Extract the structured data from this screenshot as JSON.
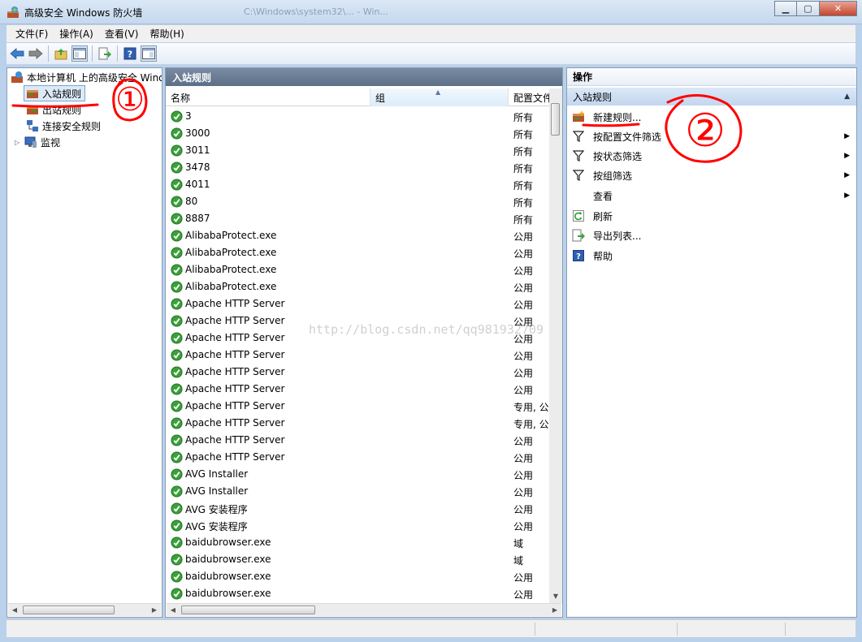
{
  "window": {
    "title": "高级安全 Windows 防火墙",
    "ghost_tab": "C:\\Windows\\system32\\... - Win..."
  },
  "menu": [
    "文件(F)",
    "操作(A)",
    "查看(V)",
    "帮助(H)"
  ],
  "tree": {
    "root": "本地计算机 上的高级安全 Windows 防火墙",
    "items": [
      {
        "label": "入站规则",
        "selected": true
      },
      {
        "label": "出站规则"
      },
      {
        "label": "连接安全规则"
      },
      {
        "label": "监视"
      }
    ]
  },
  "center": {
    "title": "入站规则",
    "columns": [
      "名称",
      "组",
      "配置文件"
    ],
    "rows": [
      {
        "name": "3",
        "profile": "所有"
      },
      {
        "name": "3000",
        "profile": "所有"
      },
      {
        "name": "3011",
        "profile": "所有"
      },
      {
        "name": "3478",
        "profile": "所有"
      },
      {
        "name": "4011",
        "profile": "所有"
      },
      {
        "name": "80",
        "profile": "所有"
      },
      {
        "name": "8887",
        "profile": "所有"
      },
      {
        "name": "AlibabaProtect.exe",
        "profile": "公用"
      },
      {
        "name": "AlibabaProtect.exe",
        "profile": "公用"
      },
      {
        "name": "AlibabaProtect.exe",
        "profile": "公用"
      },
      {
        "name": "AlibabaProtect.exe",
        "profile": "公用"
      },
      {
        "name": "Apache HTTP Server",
        "profile": "公用"
      },
      {
        "name": "Apache HTTP Server",
        "profile": "公用"
      },
      {
        "name": "Apache HTTP Server",
        "profile": "公用"
      },
      {
        "name": "Apache HTTP Server",
        "profile": "公用"
      },
      {
        "name": "Apache HTTP Server",
        "profile": "公用"
      },
      {
        "name": "Apache HTTP Server",
        "profile": "公用"
      },
      {
        "name": "Apache HTTP Server",
        "profile": "专用, 公用"
      },
      {
        "name": "Apache HTTP Server",
        "profile": "专用, 公用"
      },
      {
        "name": "Apache HTTP Server",
        "profile": "公用"
      },
      {
        "name": "Apache HTTP Server",
        "profile": "公用"
      },
      {
        "name": "AVG Installer",
        "profile": "公用"
      },
      {
        "name": "AVG Installer",
        "profile": "公用"
      },
      {
        "name": "AVG 安装程序",
        "profile": "公用"
      },
      {
        "name": "AVG 安装程序",
        "profile": "公用"
      },
      {
        "name": "baidubrowser.exe",
        "profile": "域"
      },
      {
        "name": "baidubrowser.exe",
        "profile": "域"
      },
      {
        "name": "baidubrowser.exe",
        "profile": "公用"
      },
      {
        "name": "baidubrowser.exe",
        "profile": "公用"
      }
    ]
  },
  "actions": {
    "title": "操作",
    "section": "入站规则",
    "items": [
      {
        "label": "新建规则...",
        "icon": "new-rule-icon"
      },
      {
        "label": "按配置文件筛选",
        "icon": "filter-icon",
        "submenu": true
      },
      {
        "label": "按状态筛选",
        "icon": "filter-icon",
        "submenu": true
      },
      {
        "label": "按组筛选",
        "icon": "filter-icon",
        "submenu": true
      },
      {
        "label": "查看",
        "icon": "",
        "submenu": true
      },
      {
        "label": "刷新",
        "icon": "refresh-icon"
      },
      {
        "label": "导出列表...",
        "icon": "export-icon"
      },
      {
        "label": "帮助",
        "icon": "help-icon"
      }
    ]
  },
  "watermark": "http://blog.csdn.net/qq981932709",
  "annotations": [
    "①",
    "②"
  ],
  "colors": {
    "accent": "#dceaf8",
    "annotation": "#ff0000",
    "header": "#5d6f88"
  }
}
